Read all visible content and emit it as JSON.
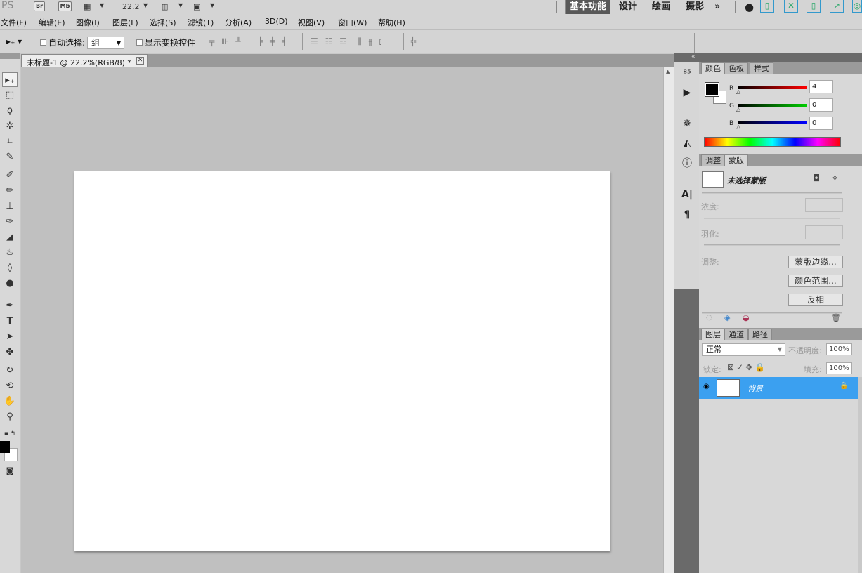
{
  "appbar": {
    "logo": "PS",
    "br": "Br",
    "mb": "Mb",
    "zoom": "22.2",
    "workspaces": [
      "基本功能",
      "设计",
      "绘画",
      "摄影"
    ],
    "more": "»"
  },
  "menu": [
    "文件(F)",
    "编辑(E)",
    "图像(I)",
    "图层(L)",
    "选择(S)",
    "滤镜(T)",
    "分析(A)",
    "3D(D)",
    "视图(V)",
    "窗口(W)",
    "帮助(H)"
  ],
  "options": {
    "auto_select_label": "自动选择:",
    "auto_select_value": "组",
    "show_transform_label": "显示变换控件"
  },
  "document": {
    "tab_title": "未标题-1 @ 22.2%(RGB/8) *",
    "close": "✕"
  },
  "color_panel": {
    "tabs": [
      "颜色",
      "色板",
      "样式"
    ],
    "r_label": "R",
    "g_label": "G",
    "b_label": "B",
    "r": "4",
    "g": "0",
    "b": "0"
  },
  "mask_panel": {
    "tabs": [
      "调整",
      "蒙版"
    ],
    "no_mask": "未选择蒙版",
    "density": "浓度:",
    "feather": "羽化:",
    "adjust": "调整:",
    "buttons": [
      "蒙版边缘...",
      "颜色范围...",
      "反相"
    ]
  },
  "layers_panel": {
    "tabs": [
      "图层",
      "通道",
      "路径"
    ],
    "blend_mode": "正常",
    "opacity_label": "不透明度:",
    "opacity": "100%",
    "lock_label": "锁定:",
    "fill_label": "填充:",
    "fill": "100%",
    "layer_name": "背景"
  },
  "colors": {
    "selection_blue": "#3ba0f0",
    "dark_dock": "#6a6a6a"
  }
}
